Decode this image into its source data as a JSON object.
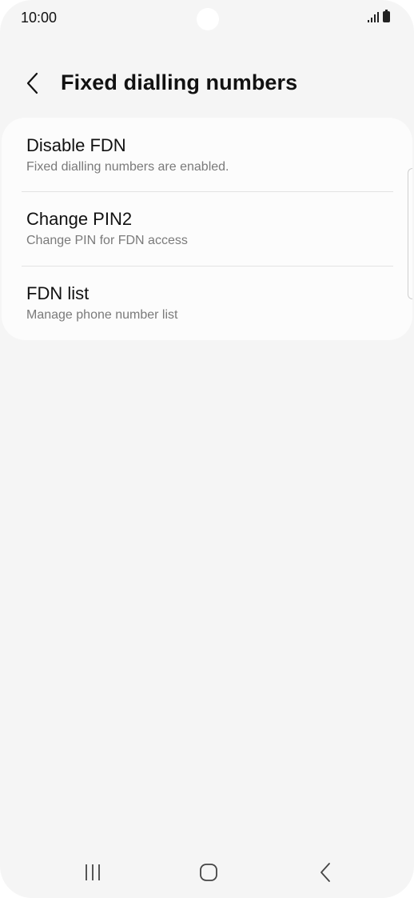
{
  "status_bar": {
    "time": "10:00"
  },
  "header": {
    "title": "Fixed dialling numbers",
    "back_icon": "chevron-left-icon"
  },
  "settings": {
    "items": [
      {
        "title": "Disable FDN",
        "subtitle": "Fixed dialling numbers are enabled."
      },
      {
        "title": "Change PIN2",
        "subtitle": "Change PIN for FDN access"
      },
      {
        "title": "FDN list",
        "subtitle": "Manage phone number list"
      }
    ]
  },
  "nav_bar": {
    "recents_icon": "recents-icon",
    "home_icon": "home-icon",
    "back_icon": "back-icon"
  },
  "colors": {
    "background": "#f5f5f5",
    "card": "#fcfcfc",
    "text_primary": "#111111",
    "text_secondary": "#7a7a7a",
    "divider": "#e3e3e3"
  }
}
